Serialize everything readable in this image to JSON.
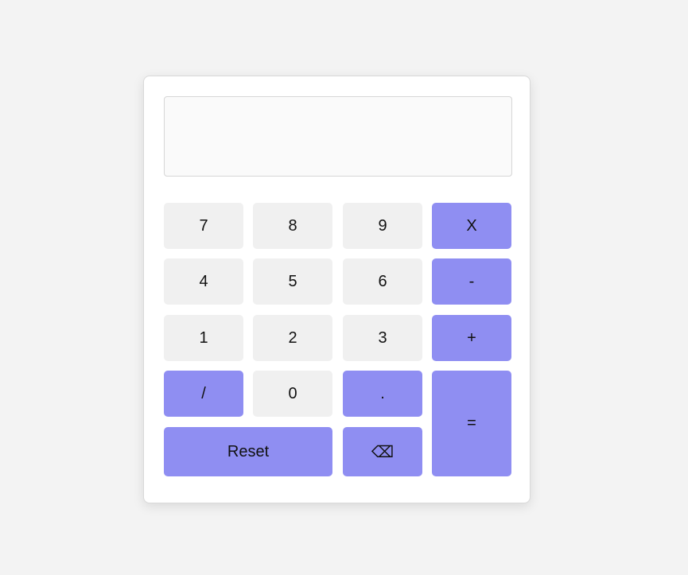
{
  "display": {
    "value": ""
  },
  "keys": {
    "seven": "7",
    "eight": "8",
    "nine": "9",
    "multiply": "X",
    "four": "4",
    "five": "5",
    "six": "6",
    "subtract": "-",
    "one": "1",
    "two": "2",
    "three": "3",
    "add": "+",
    "divide": "/",
    "zero": "0",
    "decimal": ".",
    "equals": "=",
    "reset": "Reset",
    "delete": "⌫"
  },
  "colors": {
    "background": "#f3f3f3",
    "panel": "#ffffff",
    "key": "#f0f0f0",
    "operator_key": "#8f8ef2"
  }
}
